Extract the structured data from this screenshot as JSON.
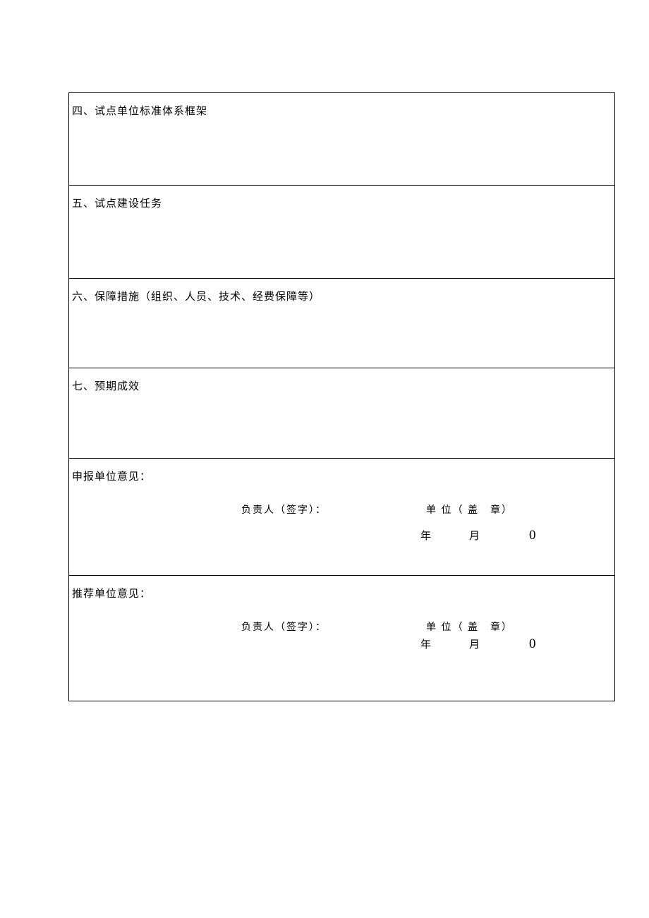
{
  "sections": {
    "section4": "四、试点单位标准体系框架",
    "section5": "五、试点建设任务",
    "section6": "六、保障措施（组织、人员、技术、经费保障等）",
    "section7": "七、预期成效"
  },
  "opinions": {
    "applicant": {
      "title": "申报单位意见：",
      "responsible_label": "负责人（签字）：",
      "seal_label": "单 位（ 盖 章）",
      "date_year": "年",
      "date_month": "月",
      "date_zero": "0"
    },
    "recommender": {
      "title": "推荐单位意见：",
      "responsible_label": "负责人（签字）：",
      "seal_label": "单 位（ 盖 章）",
      "date_year": "年",
      "date_month": "月",
      "date_zero": "0"
    }
  }
}
